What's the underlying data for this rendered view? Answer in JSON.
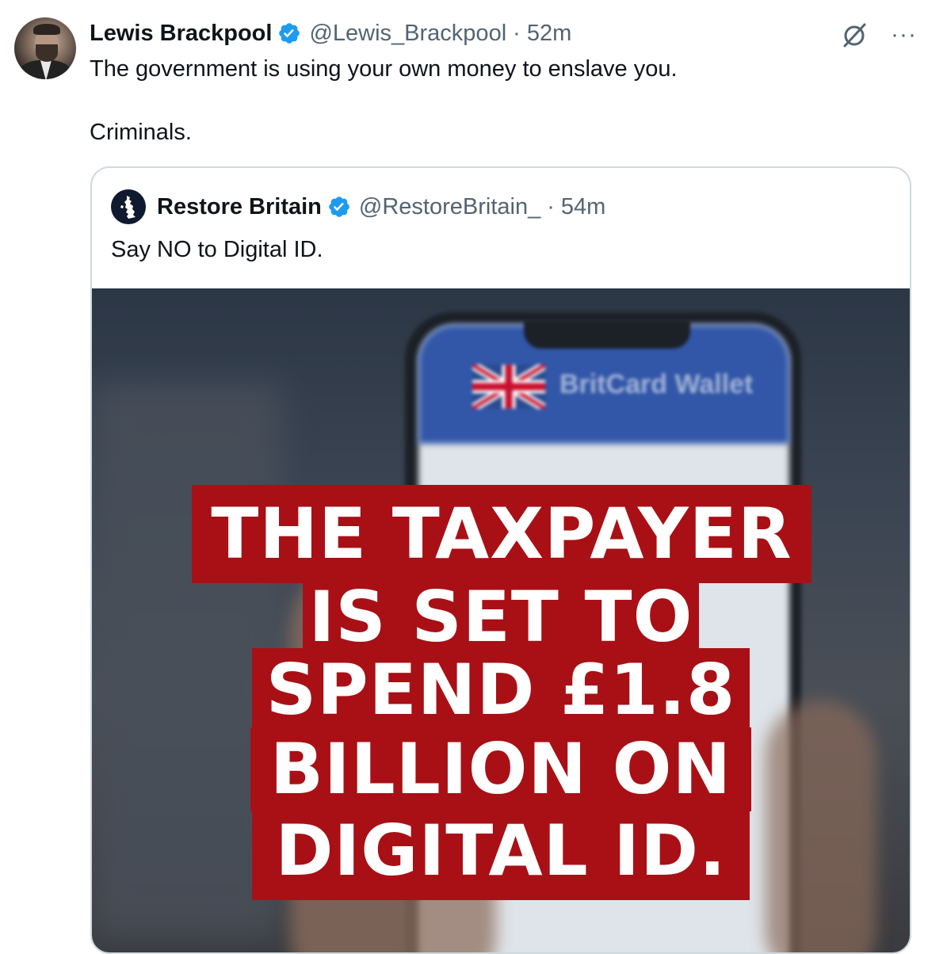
{
  "tweet": {
    "author_name": "Lewis Brackpool",
    "author_handle": "@Lewis_Brackpool",
    "separator": "·",
    "time": "52m",
    "text_line1": "The government is using your own money to enslave you.",
    "text_line2": "Criminals."
  },
  "top_actions": {
    "grok_icon": "grok-slash-circle-icon",
    "more_label": "···"
  },
  "quote": {
    "author_name": "Restore Britain",
    "author_handle": "@RestoreBritain_",
    "separator": "·",
    "time": "54m",
    "text": "Say NO to Digital ID.",
    "media": {
      "background_label": "BritCard Wallet",
      "headline_lines": [
        "THE TAXPAYER",
        "IS SET TO",
        "SPEND £1.8",
        "BILLION ON",
        "DIGITAL ID."
      ],
      "headline_bg": "#a81016"
    }
  },
  "colors": {
    "verified": "#1d9bf0",
    "secondary_text": "#536471",
    "primary_text": "#0f1419",
    "border": "#cfd9de"
  }
}
